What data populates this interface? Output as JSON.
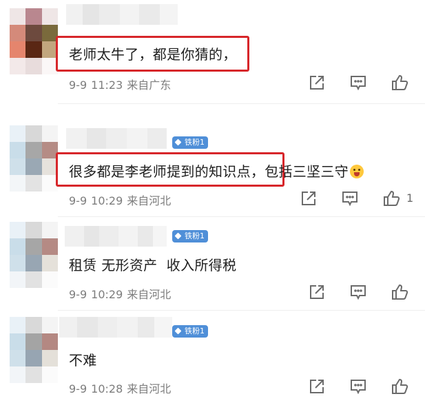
{
  "comments": [
    {
      "text": "老师太牛了，都是你猜的，",
      "highlight": true,
      "date": "9-9",
      "time": "11:23",
      "location": "来自广东",
      "badge": "",
      "likes": ""
    },
    {
      "text_highlighted": "很多都是李老师提到的知识点",
      "text_rest": "，包括三坚三守",
      "highlight": true,
      "emoji": "face-screaming-emoji",
      "date": "9-9",
      "time": "10:29",
      "location": "来自河北",
      "badge": "铁粉1",
      "likes": "1"
    },
    {
      "text": "租赁 无形资产  收入所得税",
      "highlight": false,
      "date": "9-9",
      "time": "10:29",
      "location": "来自河北",
      "badge": "铁粉1",
      "likes": ""
    },
    {
      "text": "不难",
      "highlight": false,
      "date": "9-9",
      "time": "10:28",
      "location": "来自河北",
      "badge": "铁粉1",
      "likes": ""
    }
  ],
  "icons": {
    "share": "share-icon",
    "comment": "comment-icon",
    "like": "like-icon",
    "badge": "diamond-icon"
  },
  "colors": {
    "highlight_border": "#d7262a",
    "badge_bg": "#4f8fd8",
    "meta_text": "#7d7d7d"
  }
}
